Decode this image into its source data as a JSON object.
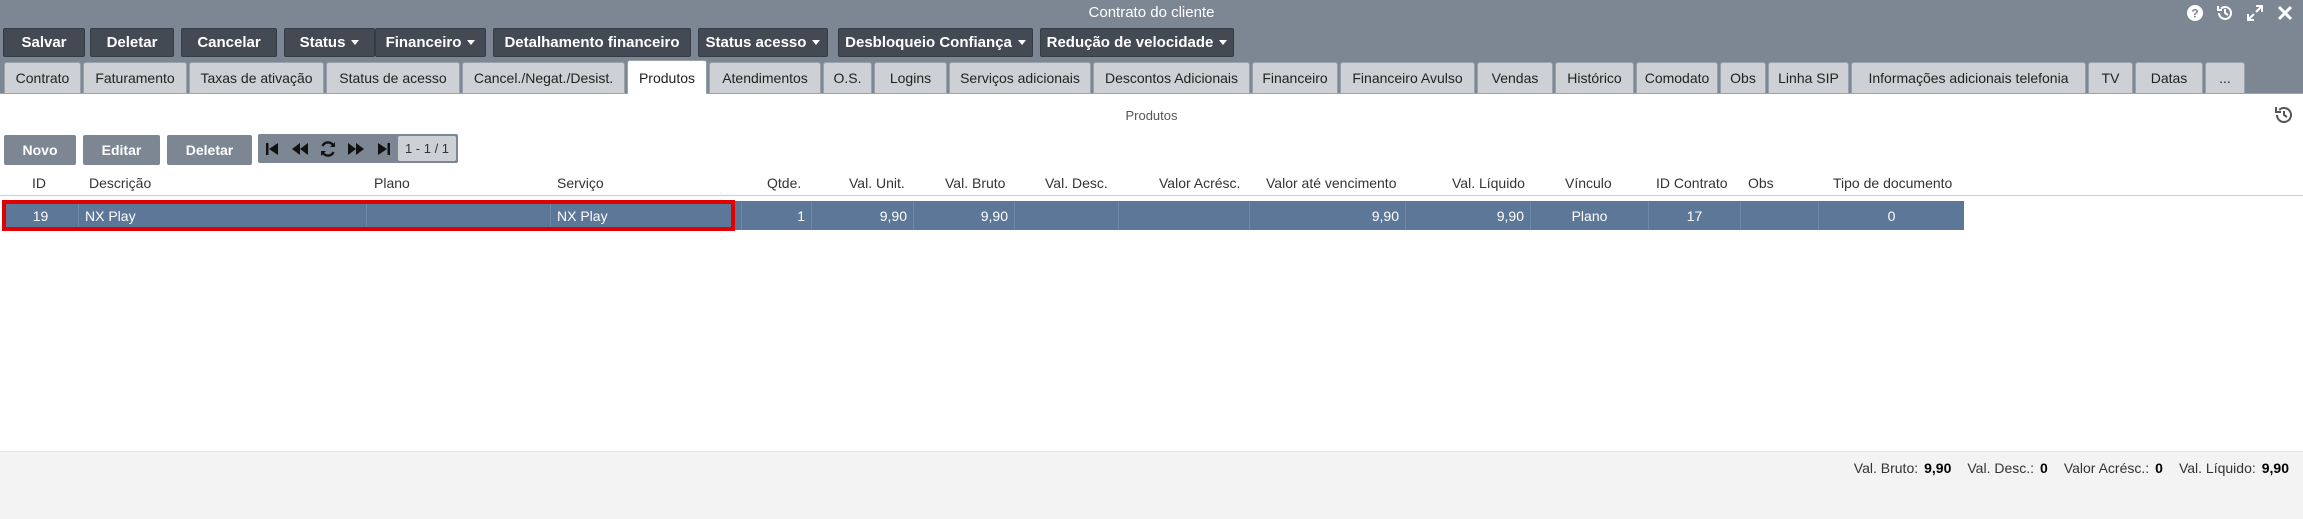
{
  "window": {
    "title": "Contrato do cliente"
  },
  "toolbar": {
    "buttons": [
      "Salvar",
      "Deletar",
      "Cancelar"
    ],
    "dropdowns": [
      "Status",
      "Financeiro"
    ],
    "detalhamento": "Detalhamento financeiro",
    "dropdowns2": [
      "Status acesso",
      "Desbloqueio Confiança",
      "Redução de velocidade"
    ]
  },
  "tabs": [
    "Contrato",
    "Faturamento",
    "Taxas de ativação",
    "Status de acesso",
    "Cancel./Negat./Desist.",
    "Produtos",
    "Atendimentos",
    "O.S.",
    "Logins",
    "Serviços adicionais",
    "Descontos Adicionais",
    "Financeiro",
    "Financeiro Avulso",
    "Vendas",
    "Histórico",
    "Comodato",
    "Obs",
    "Linha SIP",
    "Informações adicionais telefonia",
    "TV",
    "Datas",
    "..."
  ],
  "active_tab": "Produtos",
  "section": {
    "title": "Produtos"
  },
  "actions": {
    "novo": "Novo",
    "editar": "Editar",
    "deletar": "Deletar"
  },
  "pager": {
    "info": "1 - 1 / 1"
  },
  "table": {
    "columns": [
      "ID",
      "Descrição",
      "Plano",
      "Serviço",
      "Qtde.",
      "Val. Unit.",
      "Val. Bruto",
      "Val. Desc.",
      "Valor Acrésc.",
      "Valor até vencimento",
      "Val. Líquido",
      "Vínculo",
      "ID Contrato",
      "Obs",
      "Tipo de documento"
    ],
    "rows": [
      [
        "19",
        "NX Play",
        "",
        "NX Play",
        "1",
        "9,90",
        "9,90",
        "",
        "",
        "9,90",
        "9,90",
        "Plano",
        "17",
        "",
        "0"
      ]
    ]
  },
  "totals": {
    "val_bruto_label": "Val. Bruto:",
    "val_bruto": "9,90",
    "val_desc_label": "Val. Desc.:",
    "val_desc": "0",
    "valor_acresc_label": "Valor Acrésc.:",
    "valor_acresc": "0",
    "val_liquido_label": "Val. Líquido:",
    "val_liquido": "9,90"
  },
  "colors": {
    "toolbar": "#7d8794",
    "button_dark": "#434a53",
    "row_selected": "#5c7797",
    "highlight": "#e00000"
  }
}
